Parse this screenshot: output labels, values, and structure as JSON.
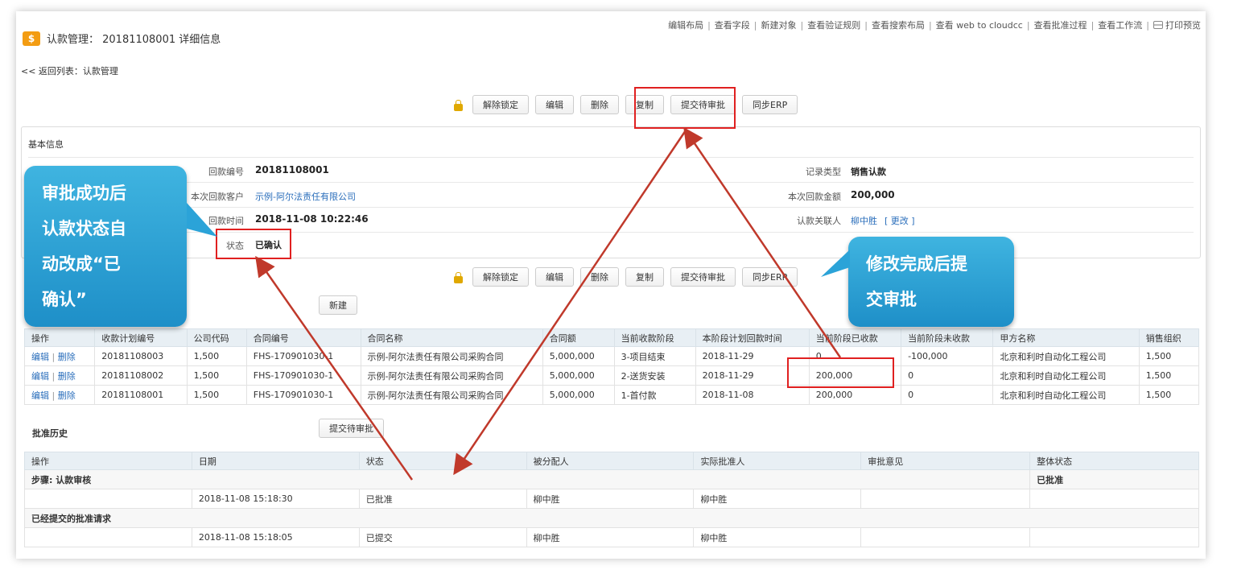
{
  "toplinks": [
    "编辑布局",
    "查看字段",
    "新建对象",
    "查看验证规则",
    "查看搜索布局",
    "查看 web to cloudcc",
    "查看批准过程",
    "查看工作流",
    "打印预览"
  ],
  "header": {
    "icon": "$",
    "title": "认款管理： 20181108001  详细信息"
  },
  "back_link": "<< 返回列表：认款管理",
  "buttons": [
    "解除锁定",
    "编辑",
    "删除",
    "复制",
    "提交待审批",
    "同步ERP"
  ],
  "basic": {
    "title": "基本信息",
    "fields": {
      "payment_no_label": "回款编号",
      "payment_no": "20181108001",
      "customer_label": "本次回款客户",
      "customer": "示例-阿尔法责任有限公司",
      "time_label": "回款时间",
      "time": "2018-11-08 10:22:46",
      "status_label": "状态",
      "status": "已确认",
      "record_type_label": "记录类型",
      "record_type": "销售认款",
      "amount_label": "本次回款金额",
      "amount": "200,000",
      "contact_label": "认款关联人",
      "contact": "柳中胜",
      "change": "[ 更改 ]"
    }
  },
  "plan": {
    "new_button": "新建",
    "headers": [
      "操作",
      "收款计划编号",
      "公司代码",
      "合同编号",
      "合同名称",
      "合同额",
      "当前收款阶段",
      "本阶段计划回款时间",
      "当前阶段已收款",
      "当前阶段未收款",
      "甲方名称",
      "销售组织"
    ],
    "action_edit": "编辑",
    "action_delete": "删除",
    "rows": [
      [
        "20181108003",
        "1,500",
        "FHS-170901030-1",
        "示例-阿尔法责任有限公司采购合同",
        "5,000,000",
        "3-项目结束",
        "2018-11-29",
        "0",
        "-100,000",
        "北京和利时自动化工程公司",
        "1,500"
      ],
      [
        "20181108002",
        "1,500",
        "FHS-170901030-1",
        "示例-阿尔法责任有限公司采购合同",
        "5,000,000",
        "2-送货安装",
        "2018-11-29",
        "200,000",
        "0",
        "北京和利时自动化工程公司",
        "1,500"
      ],
      [
        "20181108001",
        "1,500",
        "FHS-170901030-1",
        "示例-阿尔法责任有限公司采购合同",
        "5,000,000",
        "1-首付款",
        "2018-11-08",
        "200,000",
        "0",
        "北京和利时自动化工程公司",
        "1,500"
      ]
    ]
  },
  "approval": {
    "title": "批准历史",
    "submit_button": "提交待审批",
    "headers": [
      "操作",
      "日期",
      "状态",
      "被分配人",
      "实际批准人",
      "审批意见",
      "整体状态"
    ],
    "step1": {
      "label": "步骤: 认款审核",
      "overall": "已批准",
      "date": "2018-11-08 15:18:30",
      "status": "已批准",
      "assignee": "柳中胜",
      "approver": "柳中胜"
    },
    "step2": {
      "label": "已经提交的批准请求",
      "date": "2018-11-08 15:18:05",
      "status": "已提交",
      "assignee": "柳中胜",
      "approver": "柳中胜"
    }
  },
  "callouts": {
    "left": [
      "审批成功后",
      "认款状态自",
      "动改成“已",
      "确认”"
    ],
    "right": [
      "修改完成后提",
      "交审批"
    ]
  },
  "colors": {
    "accent": "#2a6ebb",
    "highlight": "#e02020",
    "callout": "#2ba3d8",
    "arrow": "#c0392b"
  }
}
